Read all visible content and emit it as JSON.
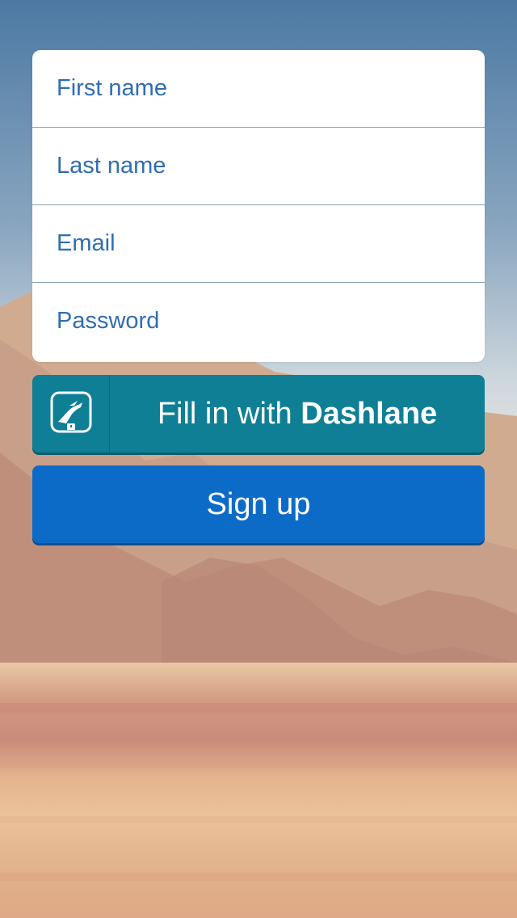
{
  "form": {
    "fields": [
      {
        "name": "first-name-field",
        "placeholder": "First name",
        "value": ""
      },
      {
        "name": "last-name-field",
        "placeholder": "Last name",
        "value": ""
      },
      {
        "name": "email-field",
        "placeholder": "Email",
        "value": ""
      },
      {
        "name": "password-field",
        "placeholder": "Password",
        "value": ""
      }
    ]
  },
  "dashlane_button": {
    "label_prefix": "Fill in with ",
    "label_brand": "Dashlane",
    "icon": "dashlane-logo-icon",
    "color": "#0e7f95"
  },
  "signup_button": {
    "label": "Sign up",
    "color": "#0d6bc8"
  },
  "background": {
    "description_icon": "desert-mountains-photo"
  }
}
